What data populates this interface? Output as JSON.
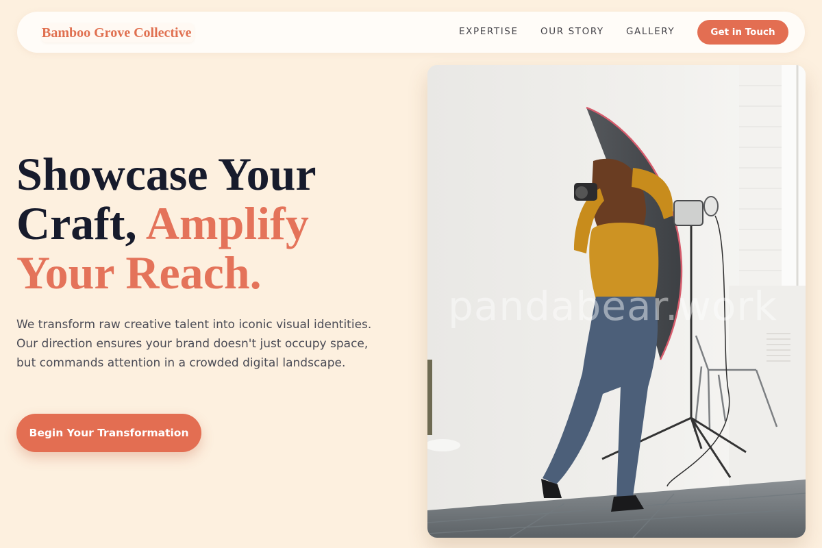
{
  "header": {
    "brand": "Bamboo Grove Collective",
    "nav": [
      "EXPERTISE",
      "OUR STORY",
      "GALLERY"
    ],
    "cta_label": "Get in Touch"
  },
  "hero": {
    "headline_part1": "Showcase Your",
    "headline_part2": "Craft, ",
    "headline_accent1": "Amplify",
    "headline_accent2": "Your Reach.",
    "description": "We transform raw creative talent into iconic visual identities. Our direction ensures your brand doesn't just occupy space, but commands attention in a crowded digital landscape.",
    "cta_label": "Begin Your Transformation"
  },
  "image": {
    "watermark": "pandabear.work"
  },
  "colors": {
    "background": "#fdf0df",
    "accent": "#e36e52",
    "ink": "#171b2c"
  }
}
